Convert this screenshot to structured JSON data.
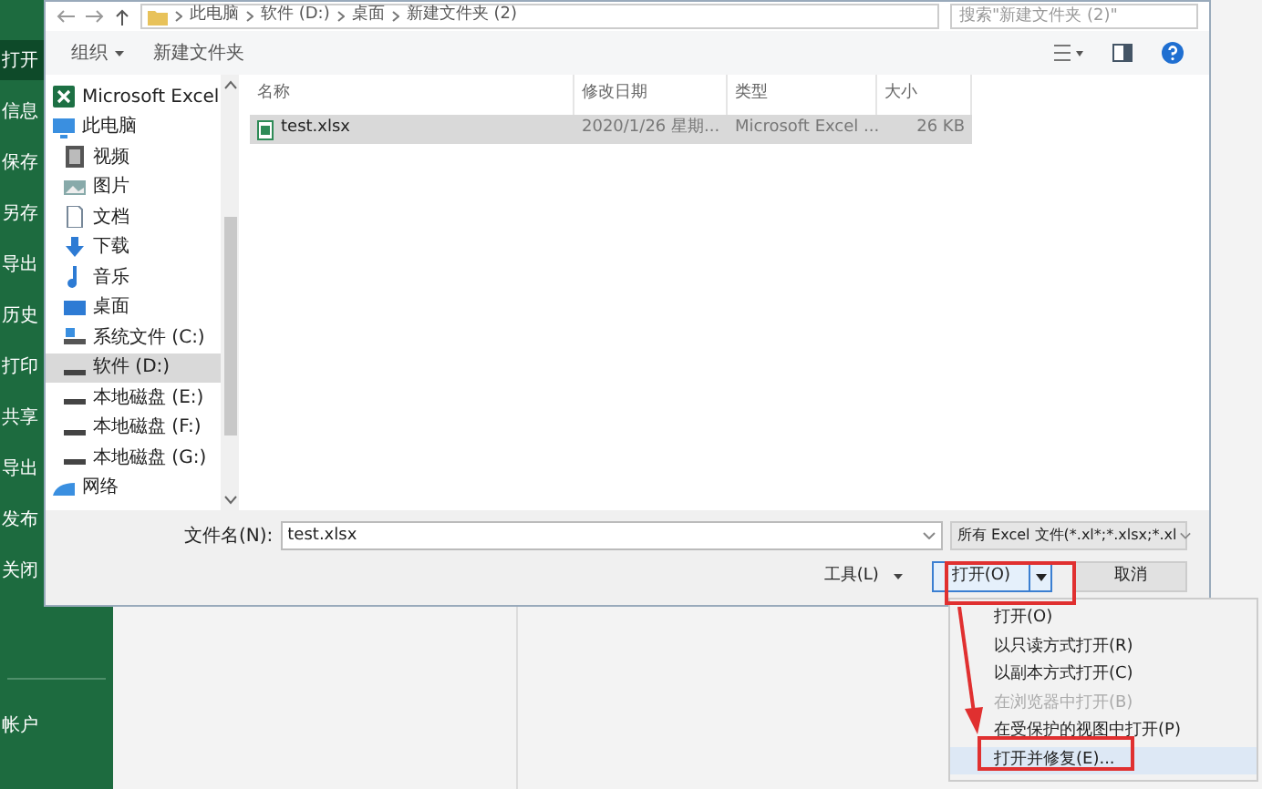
{
  "app_sidebar": {
    "items": [
      {
        "label": "打开",
        "selected": true
      },
      {
        "label": "信息",
        "selected": false
      },
      {
        "label": "保存",
        "selected": false
      },
      {
        "label": "另存",
        "selected": false
      },
      {
        "label": "导出",
        "selected": false
      },
      {
        "label": "历史",
        "selected": false
      },
      {
        "label": "打印",
        "selected": false
      },
      {
        "label": "共享",
        "selected": false
      },
      {
        "label": "导出",
        "selected": false
      },
      {
        "label": "发布",
        "selected": false
      },
      {
        "label": "关闭",
        "selected": false
      }
    ],
    "account": "帐户"
  },
  "dialog": {
    "breadcrumbs": [
      "此电脑",
      "软件 (D:)",
      "桌面",
      "新建文件夹 (2)"
    ],
    "search_placeholder": "搜索\"新建文件夹 (2)\"",
    "organize": "组织",
    "new_folder": "新建文件夹",
    "nav": [
      {
        "label": "Microsoft Excel",
        "kind": "excel",
        "selected": false
      },
      {
        "label": "此电脑",
        "kind": "pc",
        "selected": false,
        "children": [
          {
            "label": "视频",
            "kind": "video",
            "selected": false
          },
          {
            "label": "图片",
            "kind": "picture",
            "selected": false
          },
          {
            "label": "文档",
            "kind": "document",
            "selected": false
          },
          {
            "label": "下载",
            "kind": "download",
            "selected": false
          },
          {
            "label": "音乐",
            "kind": "music",
            "selected": false
          },
          {
            "label": "桌面",
            "kind": "desktop",
            "selected": false
          },
          {
            "label": "系统文件 (C:)",
            "kind": "system_drive",
            "selected": false
          },
          {
            "label": "软件 (D:)",
            "kind": "drive",
            "selected": true
          },
          {
            "label": "本地磁盘 (E:)",
            "kind": "drive",
            "selected": false
          },
          {
            "label": "本地磁盘 (F:)",
            "kind": "drive",
            "selected": false
          },
          {
            "label": "本地磁盘 (G:)",
            "kind": "drive",
            "selected": false
          }
        ]
      },
      {
        "label": "网络",
        "kind": "network",
        "selected": false
      }
    ],
    "columns": [
      "名称",
      "修改日期",
      "类型",
      "大小"
    ],
    "files": [
      {
        "name": "test.xlsx",
        "date": "2020/1/26 星期...",
        "type": "Microsoft Excel ...",
        "size": "26 KB",
        "selected": true
      }
    ],
    "filename_label": "文件名(N):",
    "filename": "test.xlsx",
    "filter": "所有 Excel 文件(*.xl*;*.xlsx;*.xl",
    "tools": "工具(L)",
    "open": "打开(O)",
    "cancel": "取消"
  },
  "menu": [
    {
      "label": "打开(O)",
      "disabled": false,
      "selected": false
    },
    {
      "label": "以只读方式打开(R)",
      "disabled": false,
      "selected": false
    },
    {
      "label": "以副本方式打开(C)",
      "disabled": false,
      "selected": false
    },
    {
      "label": "在浏览器中打开(B)",
      "disabled": true,
      "selected": false
    },
    {
      "label": "在受保护的视图中打开(P)",
      "disabled": false,
      "selected": false
    },
    {
      "label": "打开并修复(E)...",
      "disabled": false,
      "selected": true
    }
  ]
}
